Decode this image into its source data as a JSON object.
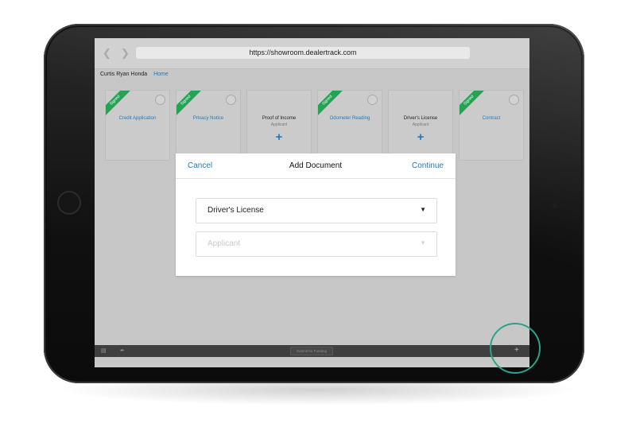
{
  "browser": {
    "back_icon": "chevron-left-icon",
    "forward_icon": "chevron-right-icon",
    "url": "https://showroom.dealertrack.com"
  },
  "breadcrumb": {
    "deal_name": "Curtis Ryan Honda",
    "home_link": "Home"
  },
  "documents": [
    {
      "title": "Credit Application",
      "signed_badge": "Signed"
    },
    {
      "title": "Privacy Notice",
      "signed_badge": "Signed"
    },
    {
      "title": "Proof of Income",
      "subtitle": "Applicant",
      "add_icon": "+"
    },
    {
      "title": "Odometer Reading",
      "signed_badge": "Signed"
    },
    {
      "title": "Driver's License",
      "subtitle": "Applicant",
      "add_icon": "+"
    },
    {
      "title": "Contract",
      "signed_badge": "Signed"
    }
  ],
  "modal": {
    "cancel_label": "Cancel",
    "title": "Add Document",
    "continue_label": "Continue",
    "document_type_value": "Driver's License",
    "applicant_placeholder": "Applicant"
  },
  "bottom_bar": {
    "submit_label": "Submit for Funding",
    "add_label": "+"
  },
  "colors": {
    "accent_blue": "#1f7bbd",
    "signed_green": "#23a353",
    "highlight_teal": "#2aa38b"
  }
}
